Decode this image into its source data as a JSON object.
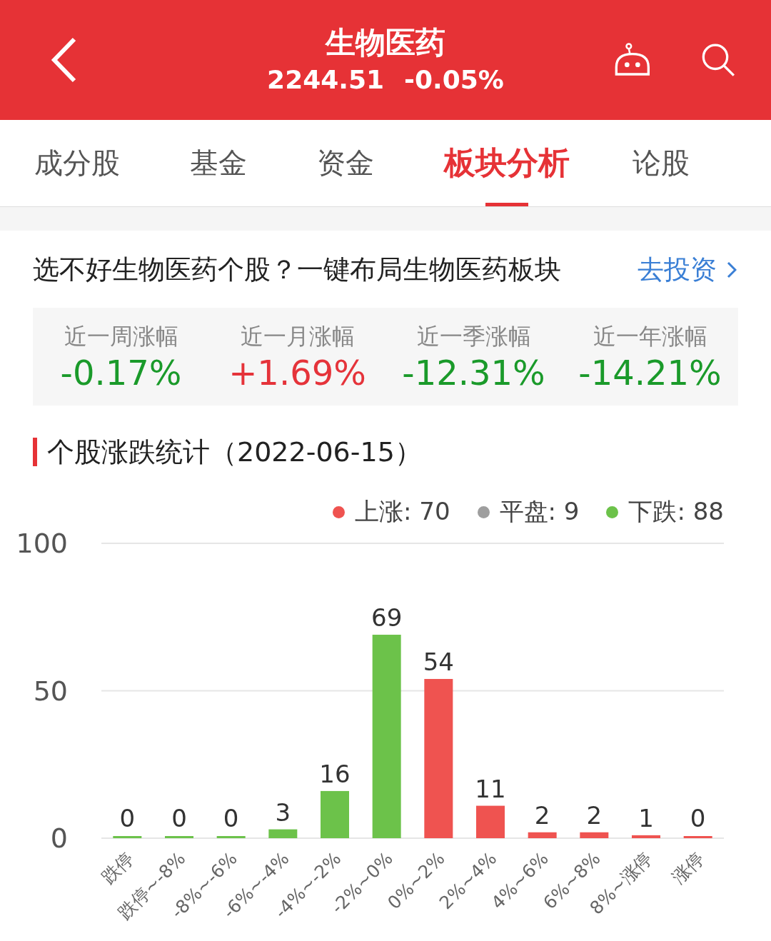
{
  "header": {
    "title": "生物医药",
    "price": "2244.51",
    "change": "-0.05%"
  },
  "tabs": [
    {
      "label": "成分股",
      "selected": false
    },
    {
      "label": "基金",
      "selected": false
    },
    {
      "label": "资金",
      "selected": false
    },
    {
      "label": "板块分析",
      "selected": true
    },
    {
      "label": "论股",
      "selected": false
    }
  ],
  "promo": {
    "text": "选不好生物医药个股？一键布局生物医药板块",
    "link": "去投资"
  },
  "stats": [
    {
      "label": "近一周涨幅",
      "value": "-0.17%",
      "kind": "down"
    },
    {
      "label": "近一月涨幅",
      "value": "+1.69%",
      "kind": "up"
    },
    {
      "label": "近一季涨幅",
      "value": "-12.31%",
      "kind": "down"
    },
    {
      "label": "近一年涨幅",
      "value": "-14.21%",
      "kind": "down"
    }
  ],
  "section_title": "个股涨跌统计（2022-06-15）",
  "legend": [
    {
      "label": "上涨: 70",
      "color": "#ef5350"
    },
    {
      "label": "平盘: 9",
      "color": "#9e9e9e"
    },
    {
      "label": "下跌: 88",
      "color": "#6cc24a"
    }
  ],
  "chart_data": {
    "type": "bar",
    "stacked": true,
    "data_labels": true,
    "ylim": [
      0,
      100
    ],
    "yticks": [
      0,
      50,
      100
    ],
    "categories": [
      "跌停",
      "跌停~-8%",
      "-8%~-6%",
      "-6%~-4%",
      "-4%~-2%",
      "-2%~0%",
      "0%~2%",
      "2%~4%",
      "4%~6%",
      "6%~8%",
      "8%~涨停",
      "涨停"
    ],
    "series": [
      {
        "color": "#6cc24a",
        "values": [
          0,
          0,
          0,
          3,
          16,
          69,
          null,
          null,
          null,
          null,
          null,
          null
        ]
      },
      {
        "color": "#ef5350",
        "values": [
          null,
          null,
          null,
          null,
          null,
          null,
          54,
          11,
          2,
          2,
          1,
          0
        ]
      }
    ]
  }
}
